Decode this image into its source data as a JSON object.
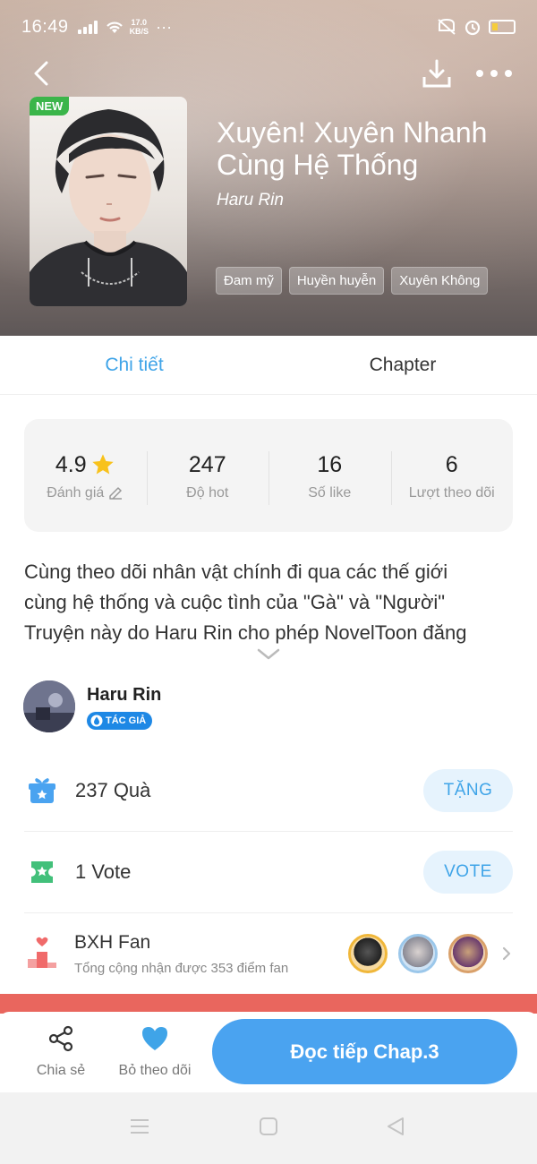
{
  "status_bar": {
    "time": "16:49",
    "speed_value": "17.0",
    "speed_unit": "KB/S",
    "more": "···"
  },
  "book": {
    "badge": "NEW",
    "title": "Xuyên! Xuyên Nhanh Cùng Hệ Thống",
    "author": "Haru Rin",
    "tags": [
      "Đam mỹ",
      "Huyền huyễn",
      "Xuyên Không"
    ]
  },
  "tabs": {
    "details": "Chi tiết",
    "chapter": "Chapter"
  },
  "stats": {
    "rating_value": "4.9",
    "rating_label": "Đánh giá",
    "hot_value": "247",
    "hot_label": "Độ hot",
    "likes_value": "16",
    "likes_label": "Số like",
    "followers_value": "6",
    "followers_label": "Lượt theo dõi"
  },
  "description": {
    "line1": "Cùng theo dõi nhân vật chính đi qua các thế giới",
    "line2": "cùng hệ thống và cuộc tình của \"Gà\" và \"Người\"",
    "line3": "Truyện này do Haru Rin cho phép NovelToon đăng"
  },
  "author_info": {
    "name": "Haru Rin",
    "badge": "TÁC GIẢ"
  },
  "gifts": {
    "count_text": "237  Quà",
    "button": "TẶNG"
  },
  "votes": {
    "count_text": "1  Vote",
    "button": "VOTE"
  },
  "fan_ranking": {
    "title": "BXH Fan",
    "subtitle": "Tổng cộng nhận được 353 điểm fan"
  },
  "bottom_bar": {
    "share": "Chia sẻ",
    "unfollow": "Bỏ theo dõi",
    "continue": "Đọc tiếp Chap.3"
  },
  "colors": {
    "accent": "#3fa4e8",
    "primary_button": "#4aa3f0",
    "new_badge": "#3bb54a",
    "gift_icon": "#4aa3f0",
    "vote_icon": "#42c07a",
    "fan_icon": "#f06a6a",
    "star": "#f8c21c"
  },
  "icons": {
    "back": "chevron-left-icon",
    "download": "download-icon",
    "more": "more-dots-icon",
    "star": "star-icon",
    "edit": "pencil-icon",
    "expand": "chevron-down-icon",
    "gift": "gift-icon",
    "vote": "ticket-icon",
    "fan": "podium-icon",
    "share": "share-icon",
    "heart": "heart-icon"
  }
}
